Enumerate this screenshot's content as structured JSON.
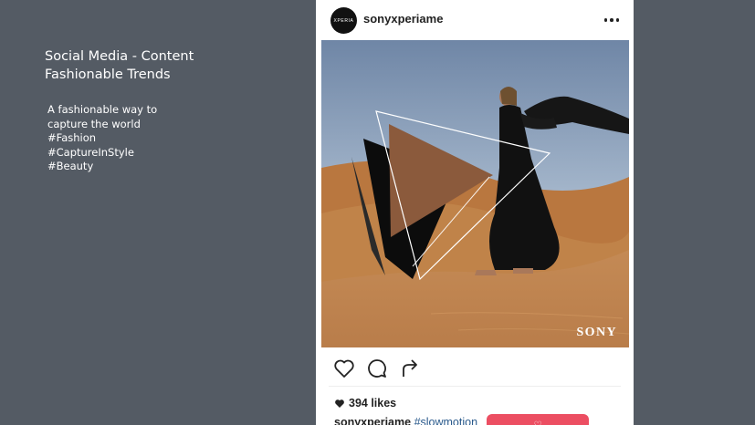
{
  "left_panel": {
    "title_line1": "Social Media - Content",
    "title_line2": "Fashionable Trends",
    "description": [
      "A fashionable way to",
      "capture the world",
      "#Fashion",
      "#CaptureInStyle",
      "#Beauty"
    ]
  },
  "post": {
    "avatar_text": "XPERIA",
    "username": "sonyxperiame",
    "brand_watermark": "SONY",
    "likes_count": "394 likes",
    "caption_user": "sonyxperiame",
    "caption_tag": "#slowmotion"
  },
  "colors": {
    "background": "#545b64",
    "accent_play": "#8b5a3c",
    "cta_pink": "#ec4e62"
  },
  "icons": {
    "more": "more-options-icon",
    "like": "heart-icon",
    "comment": "comment-icon",
    "share": "share-icon",
    "likes_heart": "heart-filled-icon"
  }
}
